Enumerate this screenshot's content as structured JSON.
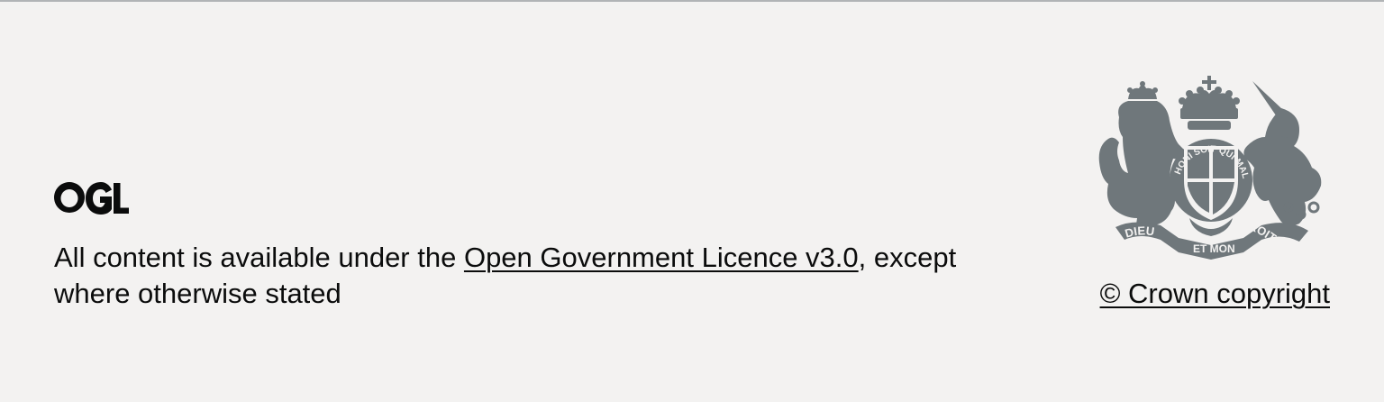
{
  "footer": {
    "logo_text": "OGL",
    "licence_prefix": "All content is available under the ",
    "licence_link": "Open Government Licence v3.0",
    "licence_suffix": ", except where otherwise stated",
    "crest_motto_garter": "HONI SOIT QUI MAL Y PENSE",
    "crest_motto_ribbon": [
      "DIEU",
      "ET MON",
      "DROIT"
    ],
    "copyright_link": "© Crown copyright",
    "colors": {
      "background": "#f3f2f1",
      "text": "#0b0c0c",
      "crest": "#6f777b",
      "border": "#b1b4b6"
    }
  }
}
